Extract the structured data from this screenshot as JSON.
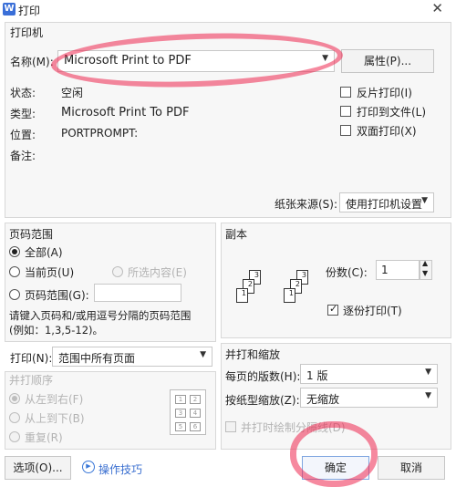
{
  "window": {
    "title": "打印",
    "app_icon": "wps-icon",
    "close_glyph": "✕"
  },
  "printer": {
    "group_title": "打印机",
    "name_label": "名称(M):",
    "name_value": "Microsoft Print to PDF",
    "properties_button": "属性(P)...",
    "status_label": "状态:",
    "status_value": "空闲",
    "type_label": "类型:",
    "type_value": "Microsoft Print To PDF",
    "location_label": "位置:",
    "location_value": "PORTPROMPT:",
    "comment_label": "备注:",
    "comment_value": "",
    "reverse_print": "反片打印(I)",
    "print_to_file": "打印到文件(L)",
    "duplex": "双面打印(X)",
    "paper_source_label": "纸张来源(S):",
    "paper_source_value": "使用打印机设置"
  },
  "page_range": {
    "group_title": "页码范围",
    "all": "全部(A)",
    "current": "当前页(U)",
    "selection": "所选内容(E)",
    "pages": "页码范围(G):",
    "pages_value": "",
    "hint_line1": "请键入页码和/或用逗号分隔的页码范围",
    "hint_line2": "(例如：1,3,5-12)。"
  },
  "print_what": {
    "label": "打印(N):",
    "value": "范围中所有页面"
  },
  "print_order": {
    "group_title": "并打顺序",
    "left_to_right": "从左到右(F)",
    "top_to_bottom": "从上到下(B)",
    "repeat": "重复(R)",
    "preview_numbers": [
      "1",
      "2",
      "3",
      "4",
      "5",
      "6"
    ]
  },
  "copies": {
    "group_title": "副本",
    "count_label": "份数(C):",
    "count_value": "1",
    "collate": "逐份打印(T)",
    "collate_checked": true,
    "page_numbers": [
      "1",
      "2",
      "3"
    ]
  },
  "zoom": {
    "group_title": "并打和缩放",
    "pages_per_sheet_label": "每页的版数(H):",
    "pages_per_sheet_value": "1 版",
    "scale_label": "按纸型缩放(Z):",
    "scale_value": "无缩放",
    "draw_border": "并打时绘制分隔线(D)"
  },
  "footer": {
    "options_button": "选项(O)...",
    "tips_link": "操作技巧",
    "ok_button": "确定",
    "cancel_button": "取消"
  },
  "colors": {
    "highlight": "#ee2850",
    "primary_border": "#7fa6e0"
  }
}
